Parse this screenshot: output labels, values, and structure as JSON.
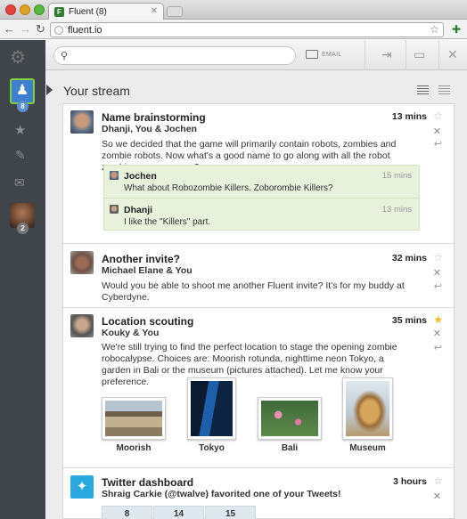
{
  "browser": {
    "tab_title": "Fluent (8)",
    "tab_favicon": "F",
    "url": "fluent.io"
  },
  "sidebar": {
    "me_badge": "8",
    "contact_badge": "2",
    "icons": [
      "logo-icon",
      "person-icon",
      "star-icon",
      "paperclip-icon",
      "mail-icon"
    ]
  },
  "appbar": {
    "search_placeholder": "",
    "email_label": "EMAIL"
  },
  "stream": {
    "title": "Your stream"
  },
  "cards": [
    {
      "subject": "Name brainstorming",
      "people": "Dhanji, You & Jochen",
      "time": "13 mins",
      "starred": false,
      "body": "So we decided that the game will primarily contain robots, zombies and zombie robots. Now what's a good name to go along with all the robot zombie awesomeness?",
      "replies": [
        {
          "name": "Jochen",
          "time": "15 mins",
          "text": "What about Robozombie Killers. Zoborombie Killers?"
        },
        {
          "name": "Dhanji",
          "time": "13 mins",
          "text": "I like the \"Killers\" part."
        }
      ]
    },
    {
      "subject": "Another invite?",
      "people": "Michael Elane & You",
      "time": "32 mins",
      "starred": false,
      "body": "Would you be able to shoot me another Fluent invite? It's for my buddy at Cyberdyne."
    },
    {
      "subject": "Location scouting",
      "people": "Kouky & You",
      "time": "35 mins",
      "starred": true,
      "body": "We're still trying to find the perfect location to stage the opening zombie robocalypse. Choices are: Moorish rotunda, nighttime neon Tokyo, a garden in Bali or the museum (pictures attached). Let me know your preference.",
      "attachments": [
        "Moorish",
        "Tokyo",
        "Bali",
        "Museum"
      ]
    },
    {
      "subject": "Twitter dashboard",
      "people": "Shraig Carkie (@twalve) favorited one of your Tweets!",
      "time": "3 hours",
      "starred": false,
      "stats": [
        "8",
        "14",
        "15"
      ]
    }
  ],
  "colors": {
    "sidebar_bg": "#40444b",
    "active_border": "#7fd13b",
    "reply_bg": "#e8f1dc",
    "star_on": "#f3b81c",
    "twitter": "#2aa9e0"
  }
}
